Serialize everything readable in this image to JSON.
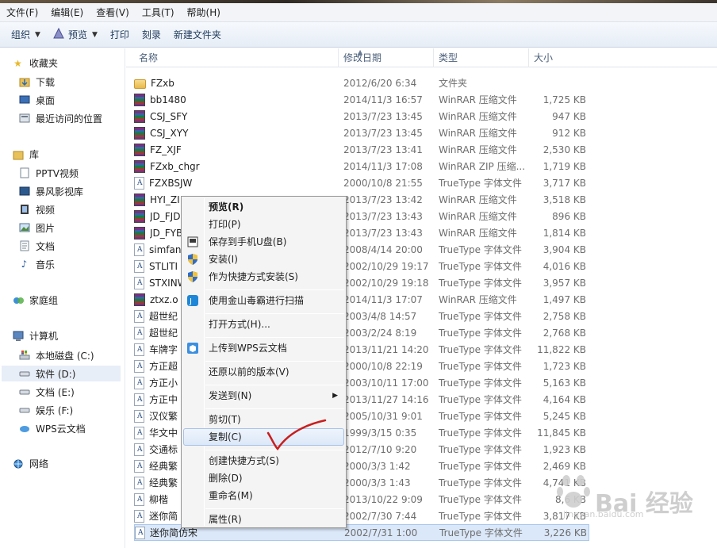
{
  "menu": [
    "文件(F)",
    "编辑(E)",
    "查看(V)",
    "工具(T)",
    "帮助(H)"
  ],
  "toolbar": {
    "organize": "组织",
    "preview": "预览",
    "print": "打印",
    "burn": "刻录",
    "new_folder": "新建文件夹"
  },
  "nav": {
    "favorites": "收藏夹",
    "favorites_items": [
      "下载",
      "桌面",
      "最近访问的位置"
    ],
    "library": "库",
    "library_items": [
      "PPTV视频",
      "暴风影视库",
      "视频",
      "图片",
      "文档",
      "音乐"
    ],
    "homegroup": "家庭组",
    "computer": "计算机",
    "computer_items": [
      "本地磁盘 (C:)",
      "软件 (D:)",
      "文档 (E:)",
      "娱乐 (F:)",
      "WPS云文档"
    ],
    "network": "网络"
  },
  "columns": {
    "name": "名称",
    "date": "修改日期",
    "type": "类型",
    "size": "大小"
  },
  "files": [
    {
      "icon": "folder",
      "name": "FZxb",
      "date": "2012/6/20 6:34",
      "type": "文件夹",
      "size": ""
    },
    {
      "icon": "rar",
      "name": "bb1480",
      "date": "2014/11/3 16:57",
      "type": "WinRAR 压缩文件",
      "size": "1,725 KB"
    },
    {
      "icon": "rar",
      "name": "CSJ_SFY",
      "date": "2013/7/23 13:45",
      "type": "WinRAR 压缩文件",
      "size": "947 KB"
    },
    {
      "icon": "rar",
      "name": "CSJ_XYY",
      "date": "2013/7/23 13:45",
      "type": "WinRAR 压缩文件",
      "size": "912 KB"
    },
    {
      "icon": "rar",
      "name": "FZ_XJF",
      "date": "2013/7/23 13:41",
      "type": "WinRAR 压缩文件",
      "size": "2,530 KB"
    },
    {
      "icon": "rar",
      "name": "FZxb_chgr",
      "date": "2014/11/3 17:08",
      "type": "WinRAR ZIP 压缩...",
      "size": "1,719 KB"
    },
    {
      "icon": "font",
      "name": "FZXBSJW",
      "date": "2000/10/8 21:55",
      "type": "TrueType 字体文件",
      "size": "3,717 KB"
    },
    {
      "icon": "rar",
      "name": "HYI_ZI",
      "date": "2013/7/23 13:42",
      "type": "WinRAR 压缩文件",
      "size": "3,518 KB"
    },
    {
      "icon": "rar",
      "name": "JD_FJD",
      "date": "2013/7/23 13:43",
      "type": "WinRAR 压缩文件",
      "size": "896 KB"
    },
    {
      "icon": "rar",
      "name": "JD_FYB",
      "date": "2013/7/23 13:43",
      "type": "WinRAR 压缩文件",
      "size": "1,814 KB"
    },
    {
      "icon": "font",
      "name": "simfang",
      "date": "2008/4/14 20:00",
      "type": "TrueType 字体文件",
      "size": "3,904 KB"
    },
    {
      "icon": "font",
      "name": "STLITI",
      "date": "2002/10/29 19:17",
      "type": "TrueType 字体文件",
      "size": "4,016 KB"
    },
    {
      "icon": "font",
      "name": "STXINWEI",
      "date": "2002/10/29 19:18",
      "type": "TrueType 字体文件",
      "size": "3,957 KB"
    },
    {
      "icon": "rar",
      "name": "ztxz.o",
      "date": "2014/11/3 17:07",
      "type": "WinRAR 压缩文件",
      "size": "1,497 KB"
    },
    {
      "icon": "font",
      "name": "超世纪",
      "date": "2003/4/8 14:57",
      "type": "TrueType 字体文件",
      "size": "2,758 KB"
    },
    {
      "icon": "font",
      "name": "超世纪",
      "date": "2003/2/24 8:19",
      "type": "TrueType 字体文件",
      "size": "2,768 KB"
    },
    {
      "icon": "font",
      "name": "车牌字",
      "date": "2013/11/21 14:20",
      "type": "TrueType 字体文件",
      "size": "11,822 KB"
    },
    {
      "icon": "font",
      "name": "方正超",
      "date": "2000/10/8 22:19",
      "type": "TrueType 字体文件",
      "size": "1,723 KB"
    },
    {
      "icon": "font",
      "name": "方正小",
      "date": "2003/10/11 17:00",
      "type": "TrueType 字体文件",
      "size": "5,163 KB"
    },
    {
      "icon": "font",
      "name": "方正中",
      "date": "2013/11/27 14:16",
      "type": "TrueType 字体文件",
      "size": "4,164 KB"
    },
    {
      "icon": "font",
      "name": "汉仪繁",
      "date": "2005/10/31 9:01",
      "type": "TrueType 字体文件",
      "size": "5,245 KB"
    },
    {
      "icon": "font",
      "name": "华文中",
      "date": "1999/3/15 0:35",
      "type": "TrueType 字体文件",
      "size": "11,845 KB"
    },
    {
      "icon": "font",
      "name": "交通标",
      "date": "2012/7/10 9:20",
      "type": "TrueType 字体文件",
      "size": "1,923 KB"
    },
    {
      "icon": "font",
      "name": "经典繁",
      "date": "2000/3/3 1:42",
      "type": "TrueType 字体文件",
      "size": "2,469 KB"
    },
    {
      "icon": "font",
      "name": "经典繁",
      "date": "2000/3/3 1:43",
      "type": "TrueType 字体文件",
      "size": "4,741 KB"
    },
    {
      "icon": "font",
      "name": "柳楷",
      "date": "2013/10/22 9:09",
      "type": "TrueType 字体文件",
      "size": "8,6 KB"
    },
    {
      "icon": "font",
      "name": "迷你简",
      "date": "2002/7/30 7:44",
      "type": "TrueType 字体文件",
      "size": "3,817 KB"
    },
    {
      "icon": "font",
      "name": "迷你简仿宋",
      "date": "2002/7/31 1:00",
      "type": "TrueType 字体文件",
      "size": "3,226 KB"
    }
  ],
  "context_menu": [
    {
      "label": "预览(R)",
      "bold": true
    },
    {
      "label": "打印(P)"
    },
    {
      "label": "保存到手机U盘(B)",
      "icon": "phone-usb-icon"
    },
    {
      "label": "安装(I)",
      "icon": "shield-icon"
    },
    {
      "label": "作为快捷方式安装(S)",
      "icon": "shield-icon"
    },
    {
      "label": "使用金山毒霸进行扫描",
      "icon": "duba-icon"
    },
    {
      "label": "打开方式(H)..."
    },
    {
      "label": "上传到WPS云文档",
      "icon": "wps-cloud-icon"
    },
    {
      "label": "还原以前的版本(V)"
    },
    {
      "label": "发送到(N)",
      "submenu": true
    },
    {
      "label": "剪切(T)"
    },
    {
      "label": "复制(C)",
      "highlighted": true
    },
    {
      "label": "创建快捷方式(S)"
    },
    {
      "label": "删除(D)"
    },
    {
      "label": "重命名(M)"
    },
    {
      "label": "属性(R)"
    }
  ],
  "watermark": {
    "text": "Bai 经验",
    "url": "jingyan.baidu.com"
  },
  "colors": {
    "selection": "#dbe8f9",
    "annotation": "#c81e1e"
  }
}
